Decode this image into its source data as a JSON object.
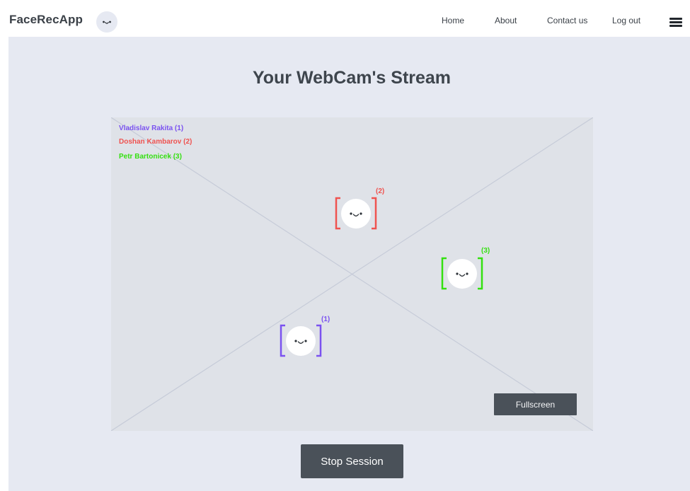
{
  "navbar": {
    "brand": "FaceRecApp",
    "links": {
      "home": "Home",
      "about": "About",
      "contact": "Contact us",
      "logout": "Log out"
    }
  },
  "main": {
    "title": "Your WebCam's Stream",
    "stream": {
      "legend": [
        {
          "name": "Vladislav Rakita (1)",
          "color": "#7b52f0"
        },
        {
          "name": "Doshan Kambarov (2)",
          "color": "#ef5350"
        },
        {
          "name": "Petr Bartonicek (3)",
          "color": "#34e010"
        }
      ],
      "faces": [
        {
          "label": "(1)",
          "color": "#7b52f0"
        },
        {
          "label": "(2)",
          "color": "#ef5350"
        },
        {
          "label": "(3)",
          "color": "#34e010"
        }
      ],
      "fullscreen_label": "Fullscreen"
    },
    "stop_label": "Stop Session"
  }
}
